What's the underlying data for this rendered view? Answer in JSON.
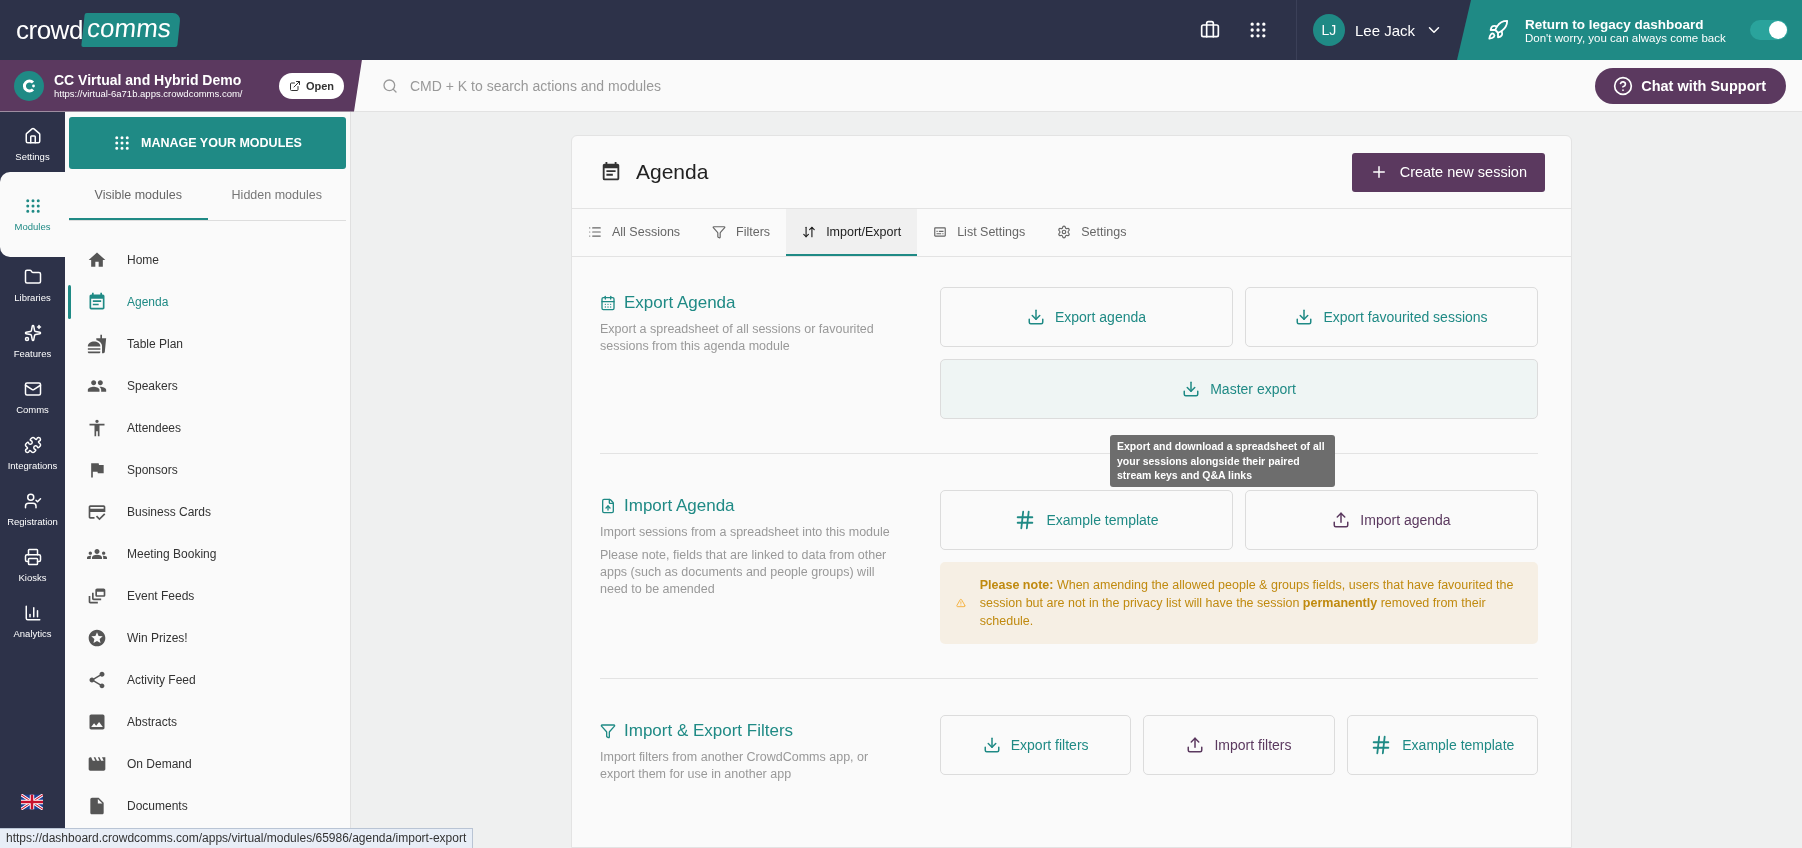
{
  "top_bar": {
    "logo": {
      "word": "crowd",
      "bubble": "comms"
    },
    "user": {
      "initials": "LJ",
      "name": "Lee Jack"
    },
    "legacy_banner": {
      "title": "Return to legacy dashboard",
      "subtitle": "Don't worry, you can always come back",
      "toggle_on": true
    }
  },
  "app_panel": {
    "name": "CC Virtual and Hybrid Demo",
    "url": "https://virtual-6a71b.apps.crowdcomms.com/",
    "open_button": "Open"
  },
  "search": {
    "placeholder": "CMD + K to search actions and modules"
  },
  "support_button": "Chat with Support",
  "rail": [
    {
      "label": "Settings",
      "selected": false
    },
    {
      "label": "Modules",
      "selected": true
    },
    {
      "label": "Libraries",
      "selected": false
    },
    {
      "label": "Features",
      "selected": false
    },
    {
      "label": "Comms",
      "selected": false
    },
    {
      "label": "Integrations",
      "selected": false
    },
    {
      "label": "Registration",
      "selected": false
    },
    {
      "label": "Kiosks",
      "selected": false
    },
    {
      "label": "Analytics",
      "selected": false
    }
  ],
  "module_panel": {
    "manage_button": "MANAGE YOUR MODULES",
    "tabs": [
      {
        "label": "Visible modules",
        "selected": true
      },
      {
        "label": "Hidden modules",
        "selected": false
      }
    ],
    "items": [
      {
        "label": "Home",
        "selected": false
      },
      {
        "label": "Agenda",
        "selected": true
      },
      {
        "label": "Table Plan",
        "selected": false
      },
      {
        "label": "Speakers",
        "selected": false
      },
      {
        "label": "Attendees",
        "selected": false
      },
      {
        "label": "Sponsors",
        "selected": false
      },
      {
        "label": "Business Cards",
        "selected": false
      },
      {
        "label": "Meeting Booking",
        "selected": false
      },
      {
        "label": "Event Feeds",
        "selected": false
      },
      {
        "label": "Win Prizes!",
        "selected": false
      },
      {
        "label": "Activity Feed",
        "selected": false
      },
      {
        "label": "Abstracts",
        "selected": false
      },
      {
        "label": "On Demand",
        "selected": false
      },
      {
        "label": "Documents",
        "selected": false
      }
    ]
  },
  "page": {
    "title": "Agenda",
    "create_button": "Create new session",
    "tabs": [
      {
        "label": "All Sessions",
        "selected": false
      },
      {
        "label": "Filters",
        "selected": false
      },
      {
        "label": "Import/Export",
        "selected": true
      },
      {
        "label": "List Settings",
        "selected": false
      },
      {
        "label": "Settings",
        "selected": false
      }
    ],
    "sections": [
      {
        "title": "Export Agenda",
        "descriptions": [
          "Export a spreadsheet of all sessions or favourited sessions from this agenda module"
        ],
        "buttons": [
          {
            "label": "Export agenda",
            "kind": "export"
          },
          {
            "label": "Export favourited sessions",
            "kind": "export"
          },
          {
            "label": "Master export",
            "kind": "master",
            "tooltip": "Export and download a spreadsheet of all your sessions alongside their paired stream keys and Q&A links"
          }
        ]
      },
      {
        "title": "Import Agenda",
        "descriptions": [
          "Import sessions from a spreadsheet into this module",
          "Please note, fields that are linked to data from other apps (such as documents and people groups) will need to be amended"
        ],
        "buttons": [
          {
            "label": "Example template",
            "kind": "template"
          },
          {
            "label": "Import agenda",
            "kind": "import"
          }
        ],
        "note": "**Please note:** When amending the allowed people & groups fields, users that have favourited the session but are not in the privacy list will have the session **permanently** removed from their schedule."
      },
      {
        "title": "Import & Export Filters",
        "descriptions": [
          "Import filters from another CrowdComms app, or export them for use in another app"
        ],
        "buttons": [
          {
            "label": "Export filters",
            "kind": "export"
          },
          {
            "label": "Import filters",
            "kind": "import"
          },
          {
            "label": "Example template",
            "kind": "template"
          }
        ]
      }
    ]
  },
  "status_url": "https://dashboard.crowdcomms.com/apps/virtual/modules/65986/agenda/import-export"
}
